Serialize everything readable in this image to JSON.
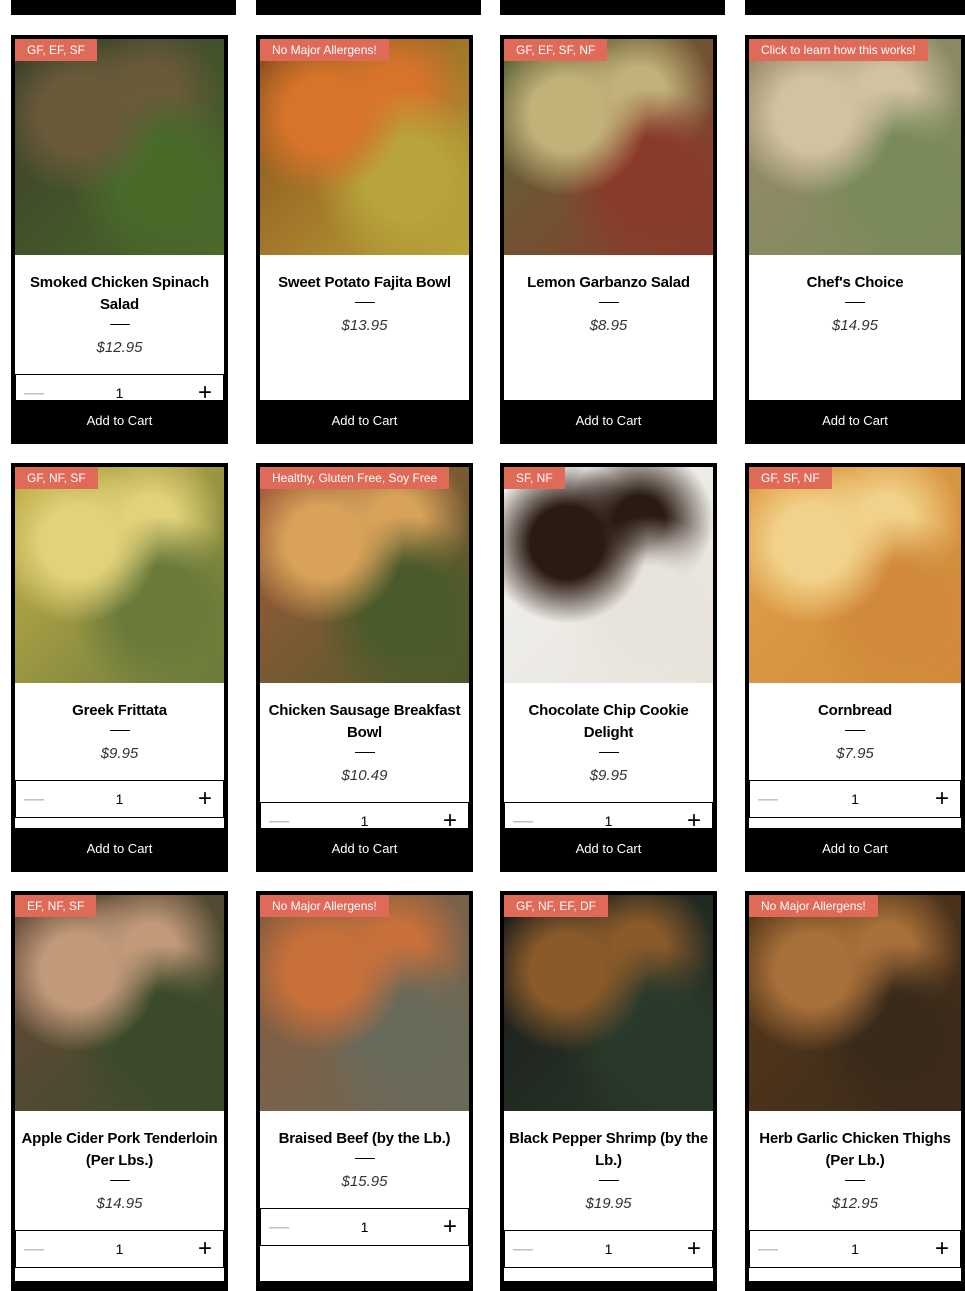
{
  "rows": [
    [
      {
        "badge": "GF, EF, SF",
        "title": "Smoked Chicken Spinach Salad",
        "price": "$12.95",
        "qty": "1",
        "has_qty": true,
        "add": "Add to Cart",
        "img": [
          "#3a3a2a",
          "#6b5a3a",
          "#4a6a2a"
        ]
      },
      {
        "badge": "No Major Allergens!",
        "title": "Sweet Potato Fajita Bowl",
        "price": "$13.95",
        "qty": "",
        "has_qty": false,
        "add": "Add to Cart",
        "img": [
          "#8a4a1a",
          "#d8742a",
          "#b8a43a"
        ]
      },
      {
        "badge": "GF, EF, SF, NF",
        "title": "Lemon Garbanzo Salad",
        "price": "$8.95",
        "qty": "",
        "has_qty": false,
        "add": "Add to Cart",
        "img": [
          "#5a6a3a",
          "#c2b27a",
          "#8a3a2a"
        ]
      },
      {
        "badge": "Click to learn how this works!",
        "title": "Chef's Choice",
        "price": "$14.95",
        "qty": "",
        "has_qty": false,
        "add": "Add to Cart",
        "img": [
          "#9a8a6a",
          "#d2c2a2",
          "#7a8a5a"
        ]
      }
    ],
    [
      {
        "badge": "GF, NF, SF",
        "title": "Greek Frittata",
        "price": "$9.95",
        "qty": "1",
        "has_qty": true,
        "add": "Add to Cart",
        "img": [
          "#c8b24a",
          "#e2d27a",
          "#6a7a3a"
        ]
      },
      {
        "badge": "Healthy, Gluten Free, Soy Free",
        "title": "Chicken Sausage Breakfast Bowl",
        "price": "$10.49",
        "qty": "1",
        "has_qty": true,
        "add": "Add to Cart",
        "img": [
          "#a85a3a",
          "#d8a25a",
          "#4a5a2a"
        ]
      },
      {
        "badge": "SF, NF",
        "title": "Chocolate Chip Cookie Delight",
        "price": "$9.95",
        "qty": "1",
        "has_qty": true,
        "add": "Add to Cart",
        "img": [
          "#f2f2f0",
          "#2a1a12",
          "#e8e4dc"
        ]
      },
      {
        "badge": "GF, SF, NF",
        "title": "Cornbread",
        "price": "$7.95",
        "qty": "1",
        "has_qty": true,
        "add": "Add to Cart",
        "img": [
          "#e2a24a",
          "#f2d28a",
          "#d08a3a"
        ]
      }
    ],
    [
      {
        "badge": "EF, NF, SF",
        "title": "Apple Cider Pork Tenderloin (Per Lbs.)",
        "price": "$14.95",
        "qty": "1",
        "has_qty": true,
        "add": "",
        "img": [
          "#6a4a3a",
          "#c29a7a",
          "#3a4a2a"
        ]
      },
      {
        "badge": "No Major Allergens!",
        "title": "Braised Beef (by the Lb.)",
        "price": "$15.95",
        "qty": "1",
        "has_qty": true,
        "add": "",
        "img": [
          "#8a5a3a",
          "#c8703a",
          "#6a6a5a"
        ]
      },
      {
        "badge": "GF, NF, EF, DF",
        "title": "Black Pepper Shrimp (by the Lb.)",
        "price": "$19.95",
        "qty": "1",
        "has_qty": true,
        "add": "",
        "img": [
          "#1a1a1a",
          "#8a5a2a",
          "#2a3a2a"
        ]
      },
      {
        "badge": "No Major Allergens!",
        "title": "Herb Garlic Chicken Thighs (Per Lb.)",
        "price": "$12.95",
        "qty": "1",
        "has_qty": true,
        "add": "",
        "img": [
          "#5a3a1a",
          "#a8703a",
          "#3a2a1a"
        ]
      }
    ]
  ],
  "colors": {
    "badge": "#e06a58",
    "card_border": "#000000",
    "button_bg": "#000000"
  },
  "icons": {
    "minus": "minus-icon",
    "plus": "plus-icon"
  }
}
